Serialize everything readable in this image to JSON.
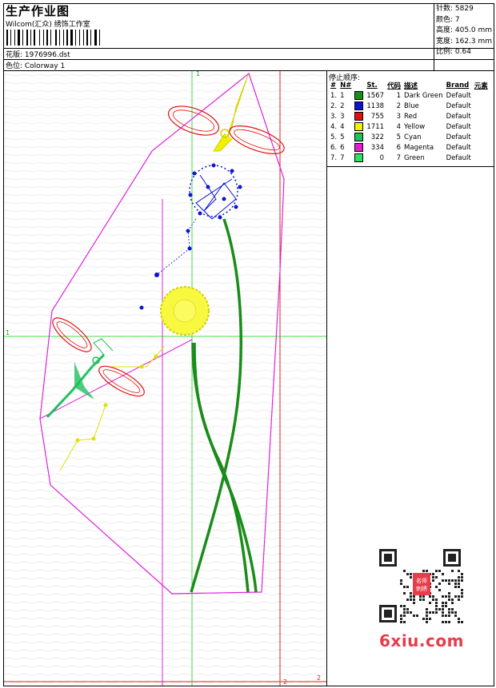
{
  "header": {
    "title": "生产作业图",
    "company": "Wilcom(汇众) 绣饰工作室",
    "design_label": "花版: 1976996.dst",
    "colorway_label": "色位: Colorway 1"
  },
  "stats": {
    "stitches": "针数: 5829",
    "colors": "颜色: 7",
    "height": "高度: 405.0 mm",
    "width": "宽度: 162.3 mm",
    "scale": "比例: 0.64"
  },
  "color_sequence": {
    "title": "停止顺序:",
    "headers": [
      "#",
      "N#",
      "St.",
      "代码",
      "描述",
      "Brand",
      "元素"
    ],
    "rows": [
      {
        "idx": "1.",
        "n": "1",
        "color": "#1a8c1a",
        "st": "1567",
        "code": "1",
        "desc": "Dark Green",
        "brand": "Default"
      },
      {
        "idx": "2.",
        "n": "2",
        "color": "#0a14d2",
        "st": "1138",
        "code": "2",
        "desc": "Blue",
        "brand": "Default"
      },
      {
        "idx": "3.",
        "n": "3",
        "color": "#e01010",
        "st": "755",
        "code": "3",
        "desc": "Red",
        "brand": "Default"
      },
      {
        "idx": "4.",
        "n": "4",
        "color": "#f0f000",
        "st": "1711",
        "code": "4",
        "desc": "Yellow",
        "brand": "Default"
      },
      {
        "idx": "5.",
        "n": "5",
        "color": "#20c060",
        "st": "322",
        "code": "5",
        "desc": "Cyan",
        "brand": "Default"
      },
      {
        "idx": "6.",
        "n": "6",
        "color": "#e020d0",
        "st": "334",
        "code": "6",
        "desc": "Magenta",
        "brand": "Default"
      },
      {
        "idx": "7.",
        "n": "7",
        "color": "#30e060",
        "st": "0",
        "code": "7",
        "desc": "Green",
        "brand": "Default"
      }
    ]
  },
  "canvas": {
    "guide_label_1": "1",
    "guide_label_2": "1",
    "guide_label_3": "2",
    "guide_label_4": "2"
  },
  "watermark": {
    "text": "6xiu.com",
    "seal_text": "名师刺绣"
  }
}
